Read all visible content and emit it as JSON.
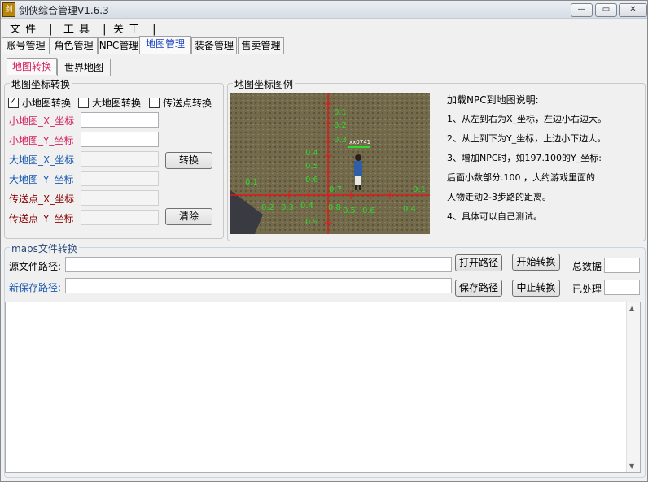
{
  "window": {
    "icon_text": "剑",
    "title": "剑侠综合管理V1.6.3",
    "min_symbol": "▭",
    "max_symbol": "▭",
    "close_symbol": "✕"
  },
  "menu": [
    {
      "label": "文件",
      "sep": "|"
    },
    {
      "label": "工具",
      "sep": "|"
    },
    {
      "label": "关于",
      "sep": "|"
    }
  ],
  "tabs": [
    "账号管理",
    "角色管理",
    "NPC管理",
    "地图管理",
    "装备管理",
    "售卖管理"
  ],
  "active_tab": "地图管理",
  "subtabs": [
    "地图转换",
    "世界地图"
  ],
  "coord": {
    "group_title": "地图坐标转换",
    "checkboxes": [
      {
        "label": "小地图转换",
        "checked": true
      },
      {
        "label": "大地图转换",
        "checked": false
      },
      {
        "label": "传送点转换",
        "checked": false
      }
    ],
    "fields": [
      {
        "label": "小地图_X_坐标",
        "value": ""
      },
      {
        "label": "小地图_Y_坐标",
        "value": ""
      },
      {
        "label": "大地图_X_坐标",
        "value": ""
      },
      {
        "label": "大地图_Y_坐标",
        "value": ""
      },
      {
        "label": "传送点_X_坐标",
        "value": ""
      },
      {
        "label": "传送点_Y_坐标",
        "value": ""
      }
    ],
    "convert_button": "转换",
    "clear_button": "清除"
  },
  "legend": {
    "group_title": "地图坐标图例",
    "info_title": "加载NPC到地图说明:",
    "info_lines": [
      "1、从左到右为X_坐标，左边小右边大。",
      "2、从上到下为Y_坐标，上边小下边大。",
      "3、增加NPC时，如197.100的Y_坐标:",
      "后面小数部分.100 ，大约游戏里面的",
      "人物走动2-3步路的距离。",
      "4、具体可以自己测试。"
    ],
    "figure_labels": {
      "top_y": [
        "0.1",
        "0.2",
        "0.3"
      ],
      "left_y": [
        "0.4",
        "0.5",
        "0.6"
      ],
      "mid_y": "0.7",
      "left_x": [
        "0.1"
      ],
      "x_left": [
        "0.2",
        "0.3",
        "0.4"
      ],
      "x_right": [
        "0.5",
        "0.6",
        "0.4"
      ],
      "bottom_y": [
        "0.8",
        "0.9"
      ],
      "right_x": "0.1",
      "npc_name": "xx0741"
    }
  },
  "maps": {
    "group_title": "maps文件转换",
    "source_label": "源文件路径:",
    "source_value": "",
    "save_label": "新保存路径:",
    "save_value": "",
    "open_path_button": "打开路径",
    "save_path_button": "保存路径",
    "start_button": "开始转换",
    "stop_button": "中止转换",
    "total_label": "总数据",
    "total_value": "",
    "processed_label": "已处理",
    "processed_value": ""
  },
  "log_text": ""
}
